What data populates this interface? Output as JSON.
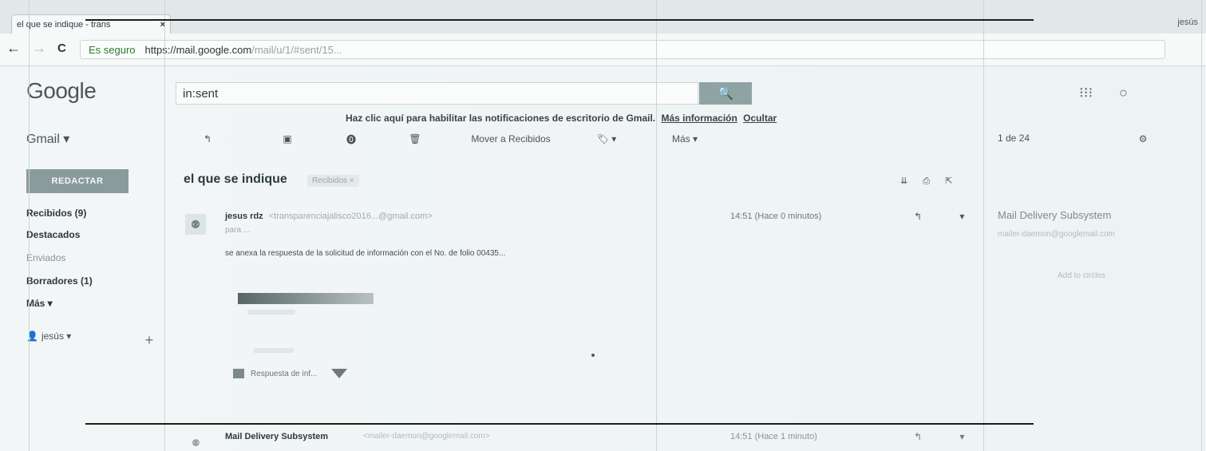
{
  "browser": {
    "tab_title": "el que se indique - trans",
    "tab_close": "×",
    "top_right": "jesús",
    "secure_label": "Es seguro",
    "url_host": "https://mail.google.com",
    "url_rest": "/mail/u/1/#sent/15...",
    "back": "←",
    "forward": "→",
    "reload": "C"
  },
  "header": {
    "logo": "Google",
    "search_value": "in:sent",
    "search_icon": "🔍",
    "apps_icon": "⁝⁝⁝",
    "account_icon": "○"
  },
  "notification": {
    "text": "Haz clic aquí para habilitar las notificaciones de escritorio de Gmail.",
    "more_link": "Más información",
    "hide_link": "Ocultar"
  },
  "gmail_label": "Gmail ▾",
  "toolbar": {
    "reply": "↰",
    "archive": "▣",
    "spam": "⓿",
    "delete": "🗑",
    "move_to": "Mover a Recibidos",
    "labels": "🏷 ▾",
    "more": "Más ▾",
    "pager": "1 de 24",
    "settings": "⚙"
  },
  "sidebar": {
    "compose": "REDACTAR",
    "items": [
      {
        "label": "Recibidos (9)",
        "style": "bold"
      },
      {
        "label": "Destacados",
        "style": "bold"
      },
      {
        "label": "Enviados",
        "style": "light"
      },
      {
        "label": "Borradores (1)",
        "style": "bold"
      },
      {
        "label": "Más ▾",
        "style": "bold"
      }
    ],
    "profile_name": "jesús ▾",
    "add": "+"
  },
  "thread": {
    "subject": "el que se indique",
    "label": "Recibidos ×",
    "tools": "⇊ ⎙ ⇱",
    "message": {
      "sender_name": "jesus rdz",
      "sender_addr": "<transparenciajalisco2016...@gmail.com>",
      "recipient": "para ...",
      "time": "14:51 (Hace 0 minutos)",
      "actions": "↰ ▾",
      "body": "se anexa la respuesta de la solicitud de información con el No. de folio 00435...",
      "attachment": "Respuesta de inf..."
    },
    "second_message": {
      "sender_name": "Mail Delivery Subsystem",
      "sender_addr": "<mailer-daemon@googlemail.com>",
      "time": "14:51 (Hace 1 minuto)",
      "actions": "↰ ▾"
    }
  },
  "people_panel": {
    "header": "",
    "name": "Mail Delivery Subsystem",
    "email": "mailer-daemon@googlemail.com",
    "more": "Add to circles"
  }
}
